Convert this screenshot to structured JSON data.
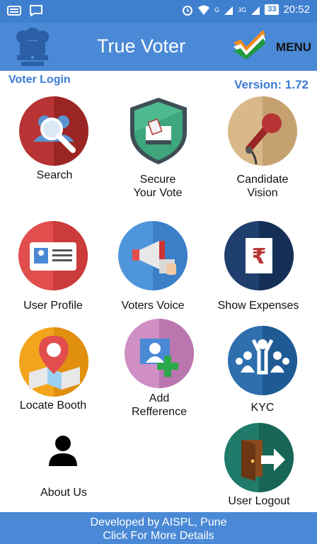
{
  "status_bar": {
    "time": "20:52",
    "battery": "33",
    "network_1": "G",
    "network_2": "3G",
    "icons": [
      "keyboard-icon",
      "chat-icon",
      "alarm-icon",
      "wifi-icon",
      "signal-icon",
      "signal-icon",
      "battery-icon"
    ]
  },
  "app_bar": {
    "title": "True Voter",
    "menu_label": "MENU"
  },
  "header": {
    "voter_login": "Voter Login",
    "version": "Version: 1.72"
  },
  "tiles": [
    {
      "label": "Search",
      "icon": "search-icon"
    },
    {
      "label_1": "Secure",
      "label_2": "Your Vote",
      "icon": "secure-vote-icon"
    },
    {
      "label_1": "Candidate",
      "label_2": "Vision",
      "icon": "microphone-icon"
    },
    {
      "label": "User Profile",
      "icon": "id-card-icon"
    },
    {
      "label": "Voters Voice",
      "icon": "megaphone-icon"
    },
    {
      "label": "Show Expenses",
      "icon": "rupee-document-icon"
    },
    {
      "label": "Locate Booth",
      "icon": "map-pin-icon"
    },
    {
      "label_1": "Add",
      "label_2": "Refference",
      "icon": "add-user-icon"
    },
    {
      "label": "KYC",
      "icon": "crowd-icon"
    },
    {
      "label": "About Us",
      "icon": "person-icon"
    },
    {
      "label": "User Logout",
      "icon": "logout-door-icon"
    }
  ],
  "footer": {
    "line1": "Developed by AISPL, Pune",
    "line2": "Click For More Details"
  },
  "colors": {
    "primary": "#4a89d6",
    "status": "#3f7fcf",
    "accent_text": "#3a7bd5"
  }
}
